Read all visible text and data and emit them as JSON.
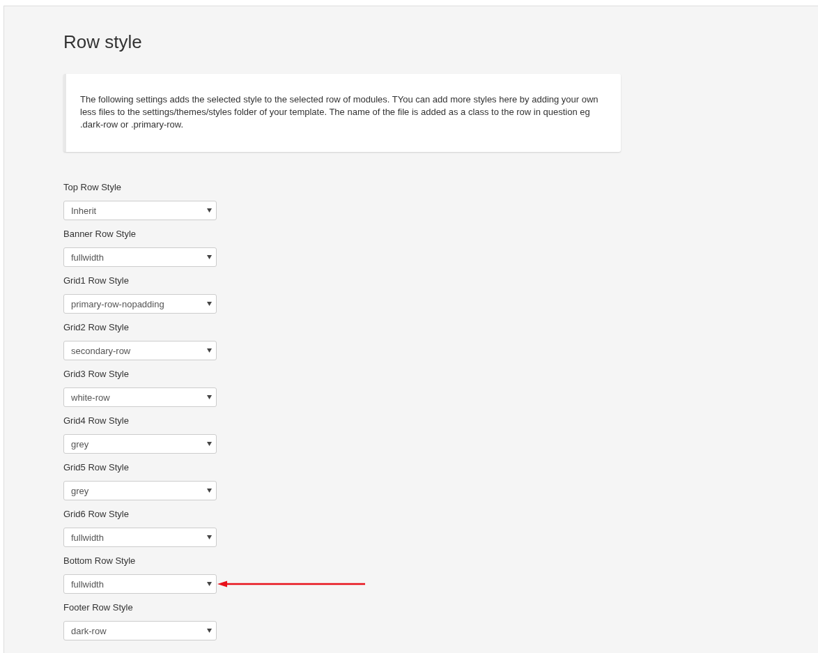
{
  "title": "Row style",
  "info": "The following settings adds the selected style to the selected row of modules. TYou can add more styles here by adding your own less files to the settings/themes/styles folder of your template. The name of the file is added as a class to the row in question eg .dark-row or .primary-row.",
  "fields": [
    {
      "label": "Top Row Style",
      "value": "Inherit",
      "marked": false
    },
    {
      "label": "Banner Row Style",
      "value": "fullwidth",
      "marked": false
    },
    {
      "label": "Grid1 Row Style",
      "value": "primary-row-nopadding",
      "marked": false
    },
    {
      "label": "Grid2 Row Style",
      "value": "secondary-row",
      "marked": false
    },
    {
      "label": "Grid3 Row Style",
      "value": "white-row",
      "marked": false
    },
    {
      "label": "Grid4 Row Style",
      "value": "grey",
      "marked": false
    },
    {
      "label": "Grid5 Row Style",
      "value": "grey",
      "marked": false
    },
    {
      "label": "Grid6 Row Style",
      "value": "fullwidth",
      "marked": false
    },
    {
      "label": "Bottom Row Style",
      "value": "fullwidth",
      "marked": true
    },
    {
      "label": "Footer Row Style",
      "value": "dark-row",
      "marked": false
    }
  ]
}
